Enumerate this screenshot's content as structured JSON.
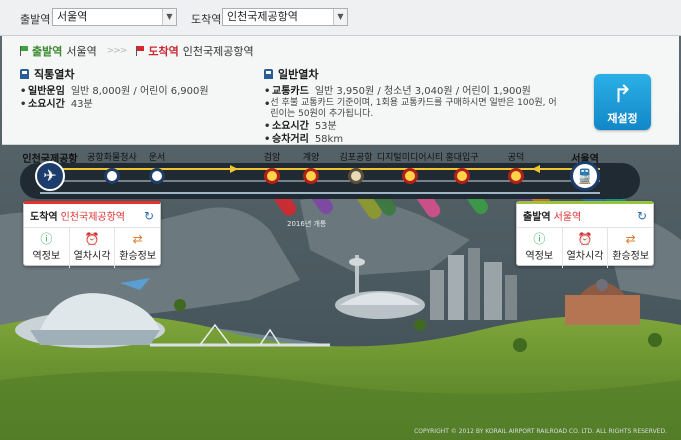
{
  "header": {
    "departure_label": "출발역",
    "departure_value": "서울역",
    "arrival_label": "도착역",
    "arrival_value": "인천국제공항역"
  },
  "route": {
    "from_label": "출발역",
    "from_station": "서울역",
    "separator": ">>>",
    "to_label": "도착역",
    "to_station": "인천국제공항역"
  },
  "express": {
    "title": "직통열차",
    "fare_label": "일반운임",
    "fare_value": "일반 8,000원 / 어린이 6,900원",
    "time_label": "소요시간",
    "time_value": "43분"
  },
  "regular": {
    "title": "일반열차",
    "card_label": "교통카드",
    "card_value": "일반 3,950원 / 청소년 3,040원 / 어린이 1,900원",
    "note": "선 후불 교통카드 기준이며, 1회용 교통카드를 구매하시면 일반은 100원, 어린이는 50원이 추가됩니다.",
    "time_label": "소요시간",
    "time_value": "53분",
    "dist_label": "승차거리",
    "dist_value": "58km"
  },
  "reset_button": {
    "label": "재설정"
  },
  "stations": [
    {
      "name": "인천국제공항"
    },
    {
      "name": "공항화물청사"
    },
    {
      "name": "운서"
    },
    {
      "name": "검암"
    },
    {
      "name": "계양"
    },
    {
      "name": "김포공항"
    },
    {
      "name": "디지털미디어시티"
    },
    {
      "name": "홍대입구"
    },
    {
      "name": "공덕"
    },
    {
      "name": "서울역"
    }
  ],
  "map_labels": {
    "opening_year": "2016년 개통"
  },
  "popup_left": {
    "label": "도착역",
    "station": "인천국제공항역",
    "btn1": "역정보",
    "btn2": "열차시각",
    "btn3": "환승정보"
  },
  "popup_right": {
    "label": "출발역",
    "station": "서울역",
    "btn1": "역정보",
    "btn2": "열차시각",
    "btn3": "환승정보"
  },
  "footer": {
    "copyright": "COPYRIGHT © 2012 BY KORAIL AIRPORT RAILROAD CO. LTD. ALL RIGHTS RESERVED."
  },
  "colors": {
    "line_blue": "#1f3e66",
    "line_yellow": "#f2c531",
    "accent_red": "#e9302d",
    "accent_green": "#99c43b",
    "reset_blue": "#1b9ad6"
  }
}
